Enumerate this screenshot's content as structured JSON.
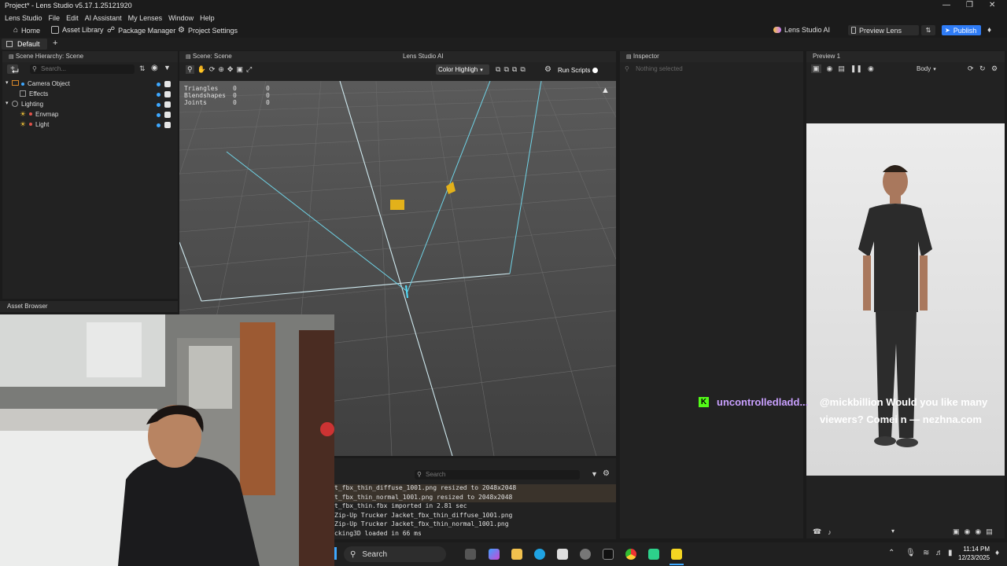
{
  "window": {
    "title": "Project* - Lens Studio v5.17.1.25121920"
  },
  "menu": [
    "Lens Studio",
    "File",
    "Edit",
    "AI Assistant",
    "My Lenses",
    "Window",
    "Help"
  ],
  "toolbar": {
    "home": "Home",
    "asset_library": "Asset Library",
    "package_manager": "Package Manager",
    "project_settings": "Project Settings",
    "lens_studio_ai": "Lens Studio AI",
    "preview_lens": "Preview Lens",
    "publish": "Publish"
  },
  "tabs": {
    "default": "Default"
  },
  "scene_hierarchy": {
    "title": "Scene Hierarchy: Scene",
    "search_placeholder": "Search...",
    "items": [
      {
        "label": "Camera Object"
      },
      {
        "label": "Effects"
      },
      {
        "label": "Lighting"
      },
      {
        "label": "Envmap"
      },
      {
        "label": "Light"
      }
    ]
  },
  "asset_browser": {
    "title": "Asset Browser"
  },
  "scene": {
    "title": "Scene: Scene",
    "ai_tab": "Lens Studio AI",
    "color_mode": "Color Highligh",
    "run_scripts": "Run Scripts",
    "stats": [
      {
        "label": "Triangles",
        "a": "0",
        "b": "0"
      },
      {
        "label": "Blendshapes",
        "a": "0",
        "b": "0"
      },
      {
        "label": "Joints",
        "a": "0",
        "b": "0"
      }
    ]
  },
  "inspector": {
    "title": "Inspector",
    "empty": "Nothing selected"
  },
  "preview": {
    "title": "Preview 1",
    "mode": "Body"
  },
  "console": {
    "search_placeholder": "Search",
    "lines": [
      "t_fbx_thin_diffuse_1001.png resized to 2048x2048",
      "t_fbx_thin_normal_1001.png resized to 2048x2048",
      "t_fbx_thin.fbx imported in 2.81 sec",
      " Zip-Up Trucker Jacket_fbx_thin_diffuse_1001.png",
      " Zip-Up Trucker Jacket_fbx_thin_normal_1001.png",
      "cking3D loaded in 66 ms"
    ]
  },
  "chat_overlay": {
    "username": "uncontrolledladd...",
    "message_line1": "@mickbillion Would you like many",
    "message_line2": "viewers? Comei n — nezhna.com"
  },
  "taskbar": {
    "search": "Search",
    "time": "11:14 PM",
    "date": "12/23/2025"
  },
  "colors": {
    "accent": "#3ea8ff",
    "publish": "#2f7cf6",
    "highlight_row": "#3a332b",
    "twitch_green": "#53fc18",
    "username": "#c9a0ff"
  }
}
